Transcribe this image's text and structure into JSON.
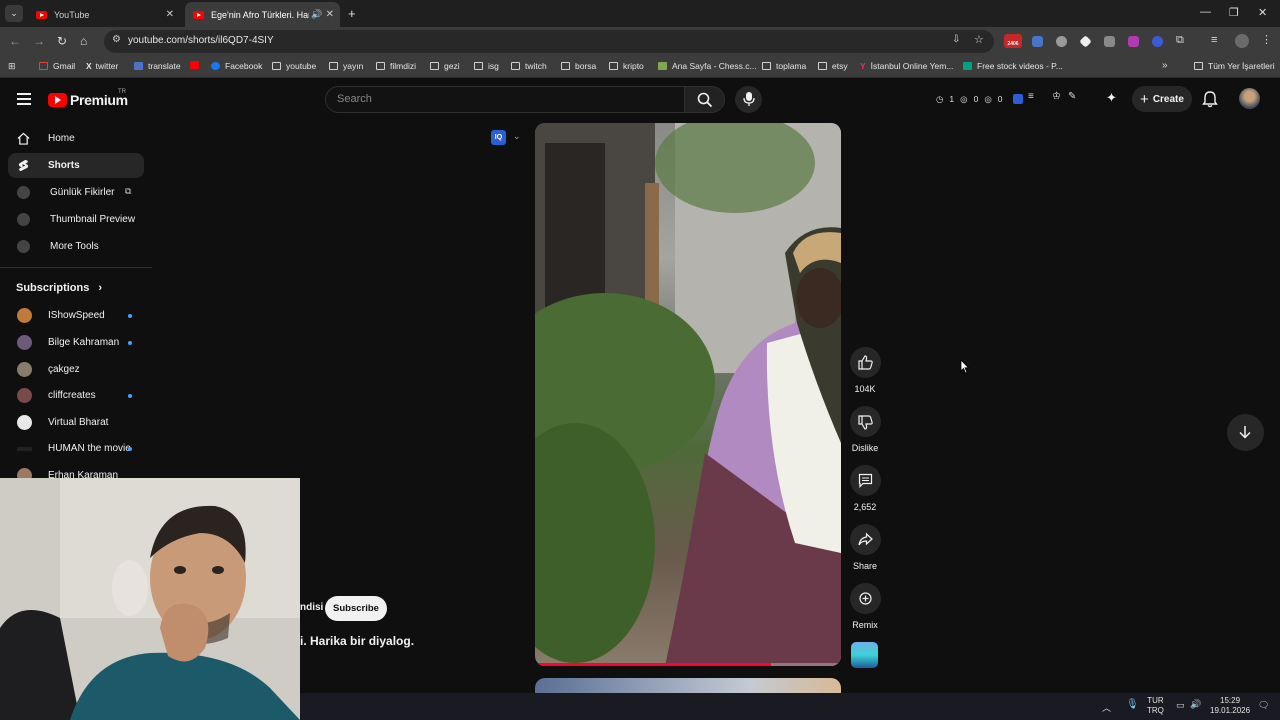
{
  "browser": {
    "tabs": [
      {
        "title": "YouTube"
      },
      {
        "title": "Ege'nin Afro Türkleri. Harika"
      }
    ],
    "url": "youtube.com/shorts/il6QD7-4SIY",
    "bookmarks": [
      "Gmail",
      "twitter",
      "translate",
      "Facebook",
      "youtube",
      "yayın",
      "filmdizi",
      "gezi",
      "isg",
      "twitch",
      "borsa",
      "kripto",
      "Ana Sayfa - Chess.c...",
      "toplama",
      "etsy",
      "İstanbul Online Yem...",
      "Free stock videos - P..."
    ],
    "all_bookmarks": "Tüm Yer İşaretleri",
    "ext_badge": "2406"
  },
  "youtube": {
    "logo_text": "Premium",
    "logo_region": "TR",
    "search_placeholder": "Search",
    "create_label": "Create",
    "stats": {
      "a": "1",
      "b": "0",
      "c": "0"
    },
    "sidebar": {
      "items": [
        {
          "label": "Home"
        },
        {
          "label": "Shorts"
        },
        {
          "label": "Günlük Fikirler"
        },
        {
          "label": "Thumbnail Preview"
        },
        {
          "label": "More Tools"
        }
      ],
      "subscriptions_title": "Subscriptions",
      "subscriptions": [
        {
          "name": "IShowSpeed"
        },
        {
          "name": "Bilge Kahraman"
        },
        {
          "name": "çakgez"
        },
        {
          "name": "cliffcreates"
        },
        {
          "name": "Virtual Bharat"
        },
        {
          "name": "HUMAN the movie"
        },
        {
          "name": "Erhan Karaman"
        }
      ]
    },
    "short": {
      "channel_fragment": "ndisi",
      "subscribe_label": "Subscribe",
      "title_fragment": "i. Harika bir diyalog.",
      "progress": 0.77,
      "likes": "104K",
      "dislike_label": "Dislike",
      "comments": "2,652",
      "share_label": "Share",
      "remix_label": "Remix"
    }
  },
  "taskbar": {
    "lang_top": "TUR",
    "lang_bottom": "TRQ",
    "time": "15:29",
    "date": "19.01.2026"
  }
}
